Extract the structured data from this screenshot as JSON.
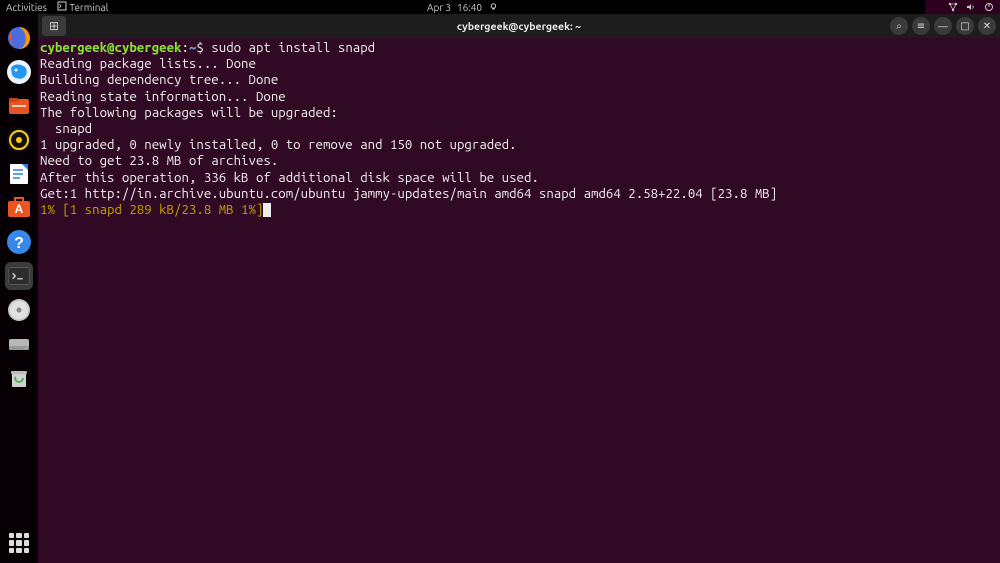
{
  "topbar": {
    "activities": "Activities",
    "app_icon": "▢",
    "app_label": "Terminal",
    "date": "Apr 3",
    "time": "16:40"
  },
  "dock": {
    "items": [
      {
        "name": "firefox-icon",
        "label": "🦊",
        "bg": "transparent"
      },
      {
        "name": "thunderbird-icon",
        "label": "🕊️",
        "bg": "#0a84ff"
      },
      {
        "name": "files-icon",
        "label": "📁",
        "bg": "#e95420"
      },
      {
        "name": "rhythmbox-icon",
        "label": "◎",
        "bg": "#fcd207"
      },
      {
        "name": "libreoffice-writer-icon",
        "label": "📄",
        "bg": "#2b7de9"
      },
      {
        "name": "software-icon",
        "label": "A",
        "bg": "#e95420"
      },
      {
        "name": "help-icon",
        "label": "?",
        "bg": "#3689e6"
      },
      {
        "name": "terminal-icon",
        "label": ">_",
        "bg": "#2d2d2d",
        "active": true
      },
      {
        "name": "drive-icon",
        "label": "⦿",
        "bg": "#c0c0c0"
      },
      {
        "name": "disk-icon",
        "label": "▭",
        "bg": "#b0b0b0"
      },
      {
        "name": "trash-icon",
        "label": "♻",
        "bg": "#c0c0c0"
      }
    ]
  },
  "window": {
    "title": "cybergeek@cybergeek: ~",
    "new_tab": "⊞",
    "controls": {
      "search": "⌕",
      "menu": "≡",
      "minimize": "—",
      "maximize": "□",
      "close": "✕"
    }
  },
  "terminal": {
    "prompt_user": "cybergeek@cybergeek",
    "prompt_sep": ":",
    "prompt_path": "~",
    "prompt_dollar": "$ ",
    "command": "sudo apt install snapd",
    "lines": [
      "Reading package lists... Done",
      "Building dependency tree... Done",
      "Reading state information... Done",
      "The following packages will be upgraded:",
      "  snapd",
      "1 upgraded, 0 newly installed, 0 to remove and 150 not upgraded.",
      "Need to get 23.8 MB of archives.",
      "After this operation, 336 kB of additional disk space will be used.",
      "Get:1 http://in.archive.ubuntu.com/ubuntu jammy-updates/main amd64 snapd amd64 2.58+22.04 [23.8 MB]"
    ],
    "progress": "1% [1 snapd 289 kB/23.8 MB 1%]"
  }
}
